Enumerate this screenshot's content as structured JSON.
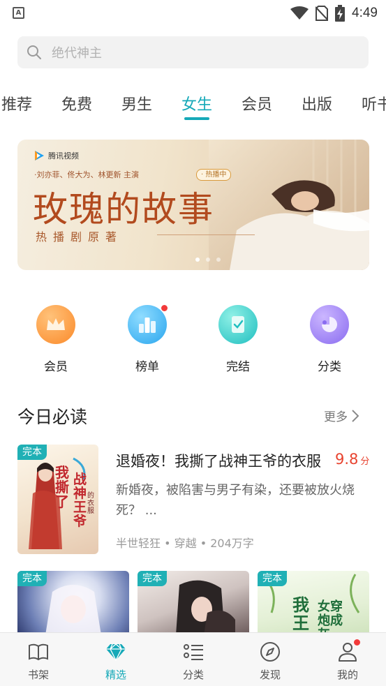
{
  "status_bar": {
    "time": "4:49",
    "app_badge": "A"
  },
  "search": {
    "placeholder": "绝代神主"
  },
  "tabs": [
    {
      "label": "推荐"
    },
    {
      "label": "免费"
    },
    {
      "label": "男生"
    },
    {
      "label": "女生",
      "active": true
    },
    {
      "label": "会员"
    },
    {
      "label": "出版"
    },
    {
      "label": "听书"
    }
  ],
  "banner": {
    "logo_text": "腾讯视频",
    "cast": "·刘亦菲、佟大为、林更新 主演",
    "badge": "· 热播中",
    "title": "玫瑰的故事",
    "subtitle": "热播剧原著",
    "slide_count": 3,
    "active_slide": 1
  },
  "quick_entries": [
    {
      "label": "会员",
      "icon": "crown-icon",
      "color": "#fb9a3c",
      "has_dot": false
    },
    {
      "label": "榜单",
      "icon": "ranking-icon",
      "color": "#3cb3f2",
      "has_dot": true
    },
    {
      "label": "完结",
      "icon": "finished-book-icon",
      "color": "#2fc6c6",
      "has_dot": false
    },
    {
      "label": "分类",
      "icon": "category-icon",
      "color": "#9a7df2",
      "has_dot": false
    }
  ],
  "section": {
    "title": "今日必读",
    "more_label": "更多"
  },
  "featured_book": {
    "tag": "完本",
    "title": "退婚夜！我撕了战神王爷的衣服",
    "score": "9.8",
    "score_unit": "分",
    "description": "新婚夜，被陷害与男子有染，还要被放火烧死？ ...",
    "meta": "半世轻狂 • 穿越 • 204万字",
    "cover_text_a": "我撕了",
    "cover_text_b": "战神王爷",
    "cover_text_c": "的衣服"
  },
  "grid_books": [
    {
      "tag": "完本"
    },
    {
      "tag": "完本"
    },
    {
      "tag": "完本",
      "cover_text_a": "我王",
      "cover_text_b": "女穿炮成灰"
    }
  ],
  "bottom_nav": [
    {
      "label": "书架",
      "icon": "bookshelf-icon"
    },
    {
      "label": "精选",
      "icon": "diamond-icon",
      "active": true
    },
    {
      "label": "分类",
      "icon": "list-icon"
    },
    {
      "label": "发现",
      "icon": "compass-icon"
    },
    {
      "label": "我的",
      "icon": "profile-icon",
      "has_dot": true
    }
  ],
  "colors": {
    "accent": "#16a9b8",
    "tag": "#20b0b5",
    "score": "#e8432f",
    "dot": "#f23a3a"
  }
}
